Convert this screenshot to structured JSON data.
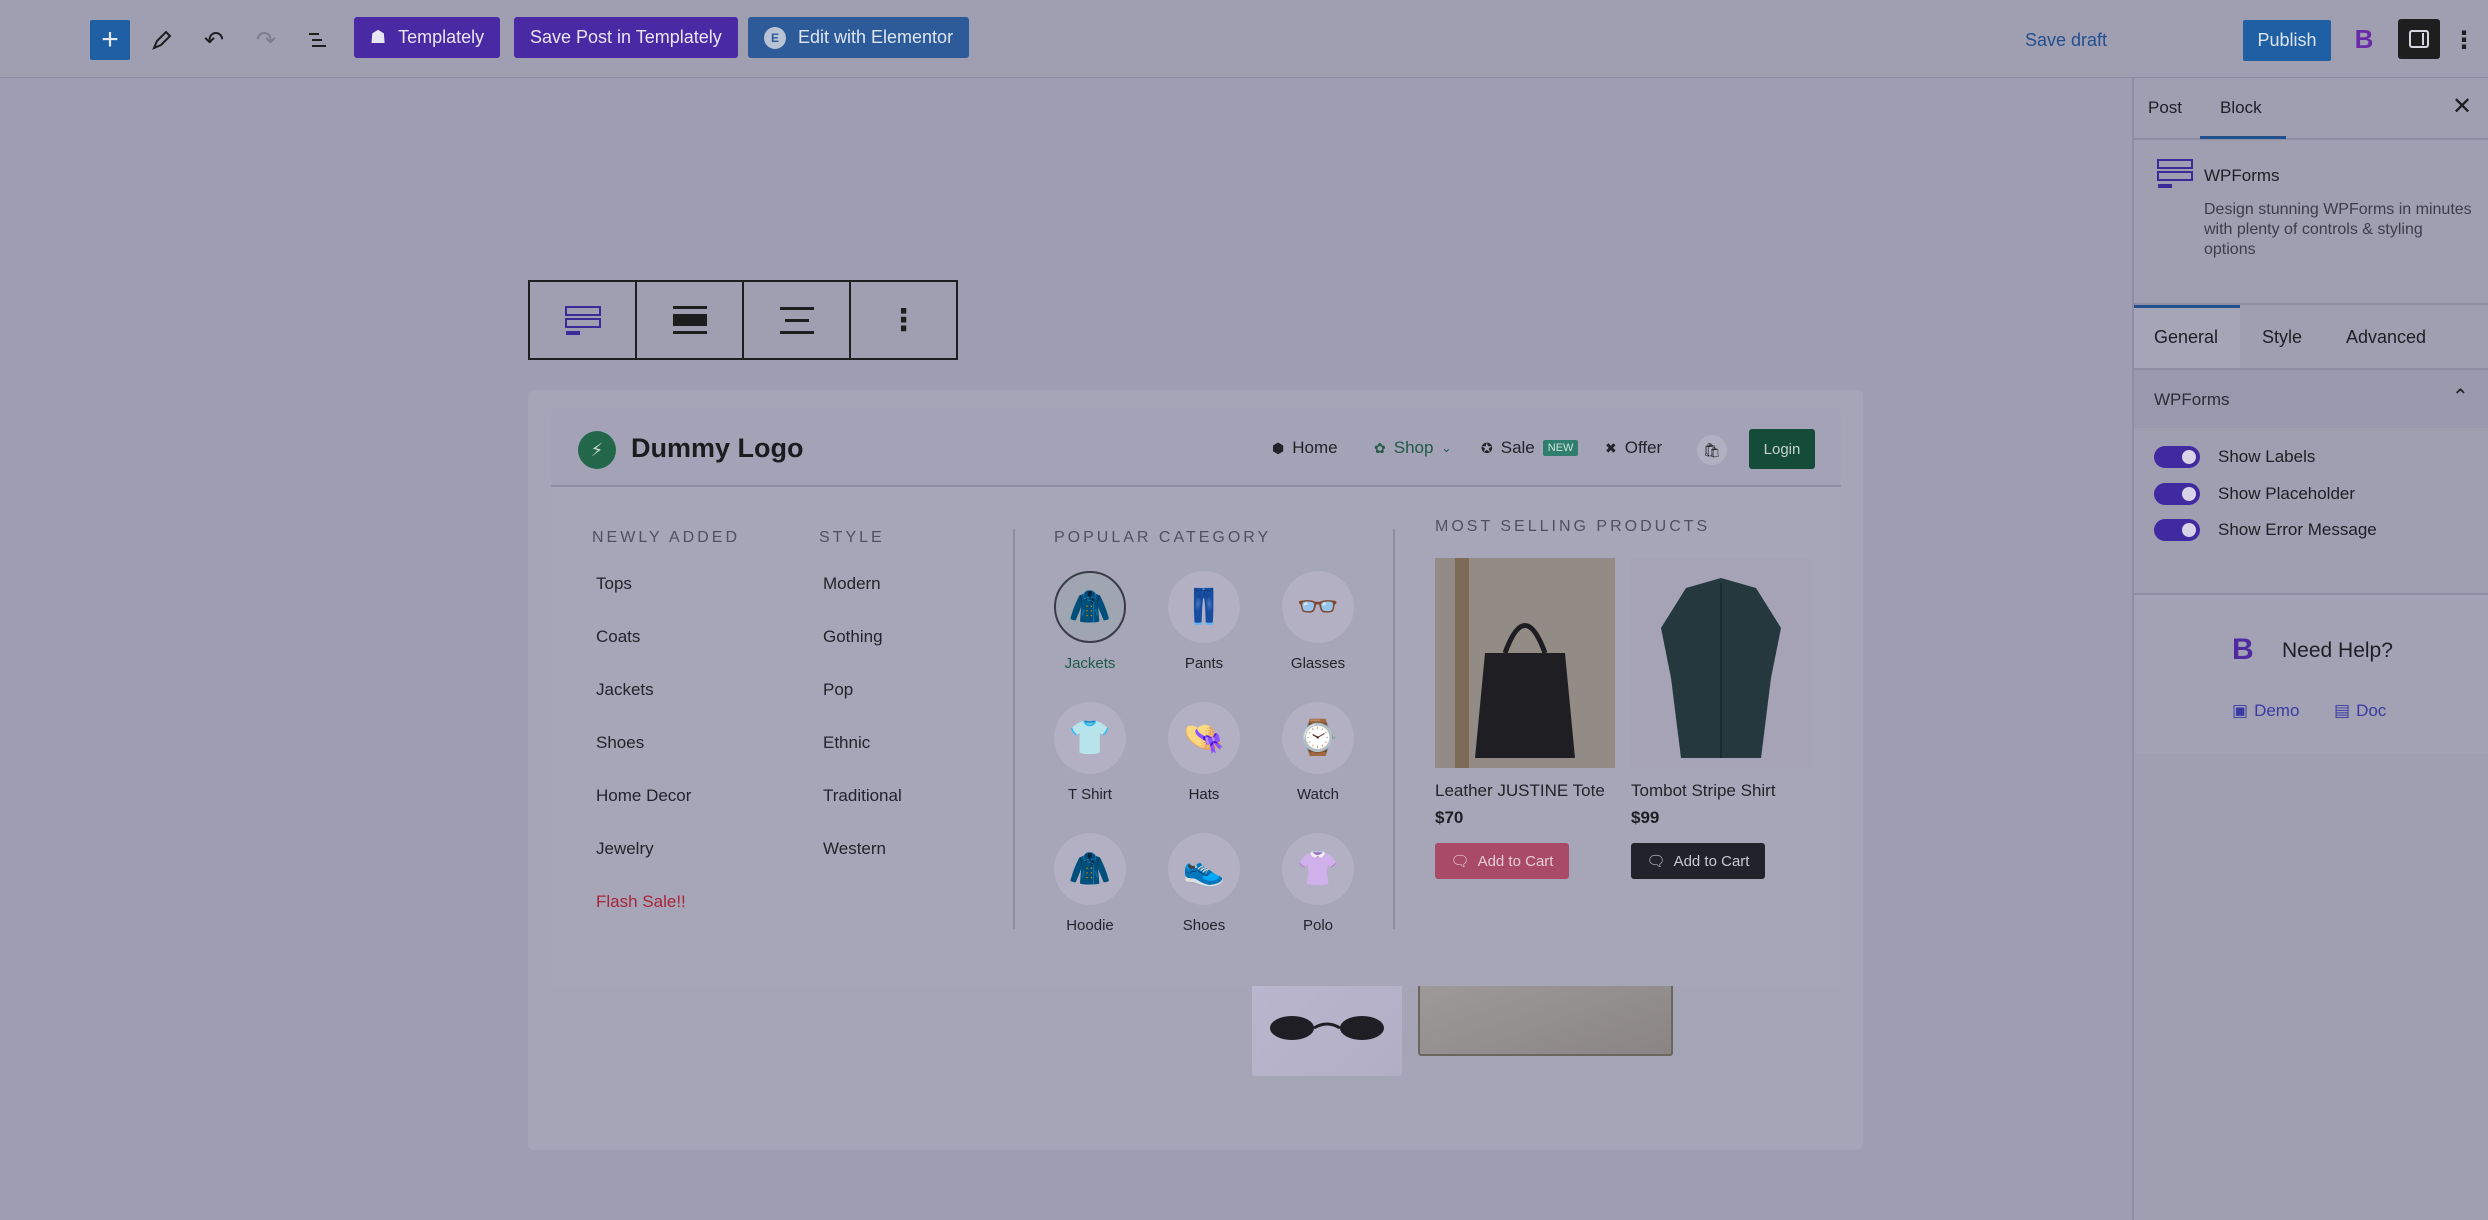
{
  "topbar": {
    "add_icon": "plus-icon",
    "templately_label": "Templately",
    "save_templately_label": "Save Post in Templately",
    "elementor_label": "Edit with Elementor",
    "save_draft_label": "Save draft",
    "publish_label": "Publish"
  },
  "menu": {
    "logo_text": "Dummy Logo",
    "nav": {
      "home": "Home",
      "shop": "Shop",
      "sale": "Sale",
      "new_badge": "NEW",
      "offer": "Offer",
      "login": "Login"
    },
    "newly_added": {
      "title": "NEWLY ADDED",
      "items": [
        "Tops",
        "Coats",
        "Jackets",
        "Shoes",
        "Home Decor",
        "Jewelry",
        "Flash Sale!!"
      ]
    },
    "style": {
      "title": "STYLE",
      "items": [
        "Modern",
        "Gothing",
        "Pop",
        "Ethnic",
        "Traditional",
        "Western"
      ]
    },
    "popular": {
      "title": "POPULAR CATEGORY",
      "items": [
        {
          "label": "Jackets",
          "icon": "jacket-icon"
        },
        {
          "label": "Pants",
          "icon": "pants-icon"
        },
        {
          "label": "Glasses",
          "icon": "glasses-icon"
        },
        {
          "label": "T Shirt",
          "icon": "tshirt-icon"
        },
        {
          "label": "Hats",
          "icon": "hat-icon"
        },
        {
          "label": "Watch",
          "icon": "watch-icon"
        },
        {
          "label": "Hoodie",
          "icon": "hoodie-icon"
        },
        {
          "label": "Shoes",
          "icon": "shoes-icon"
        },
        {
          "label": "Polo",
          "icon": "polo-icon"
        }
      ]
    },
    "best": {
      "title": "MOST SELLING PRODUCTS",
      "products": [
        {
          "name": "Leather JUSTINE Tote",
          "price": "$70",
          "button": "Add to Cart"
        },
        {
          "name": "Tombot Stripe Shirt",
          "price": "$99",
          "button": "Add to Cart"
        }
      ]
    }
  },
  "sidebar": {
    "tabs": [
      "Post",
      "Block"
    ],
    "block_name": "WPForms",
    "block_desc": "Design stunning WPForms in minutes with plenty of controls & styling options",
    "subtabs": [
      "General",
      "Style",
      "Advanced"
    ],
    "panel_title": "WPForms",
    "toggles": [
      "Show Labels",
      "Show Placeholder",
      "Show Error Message"
    ],
    "help_title": "Need Help?",
    "demo_label": "Demo",
    "doc_label": "Doc"
  }
}
